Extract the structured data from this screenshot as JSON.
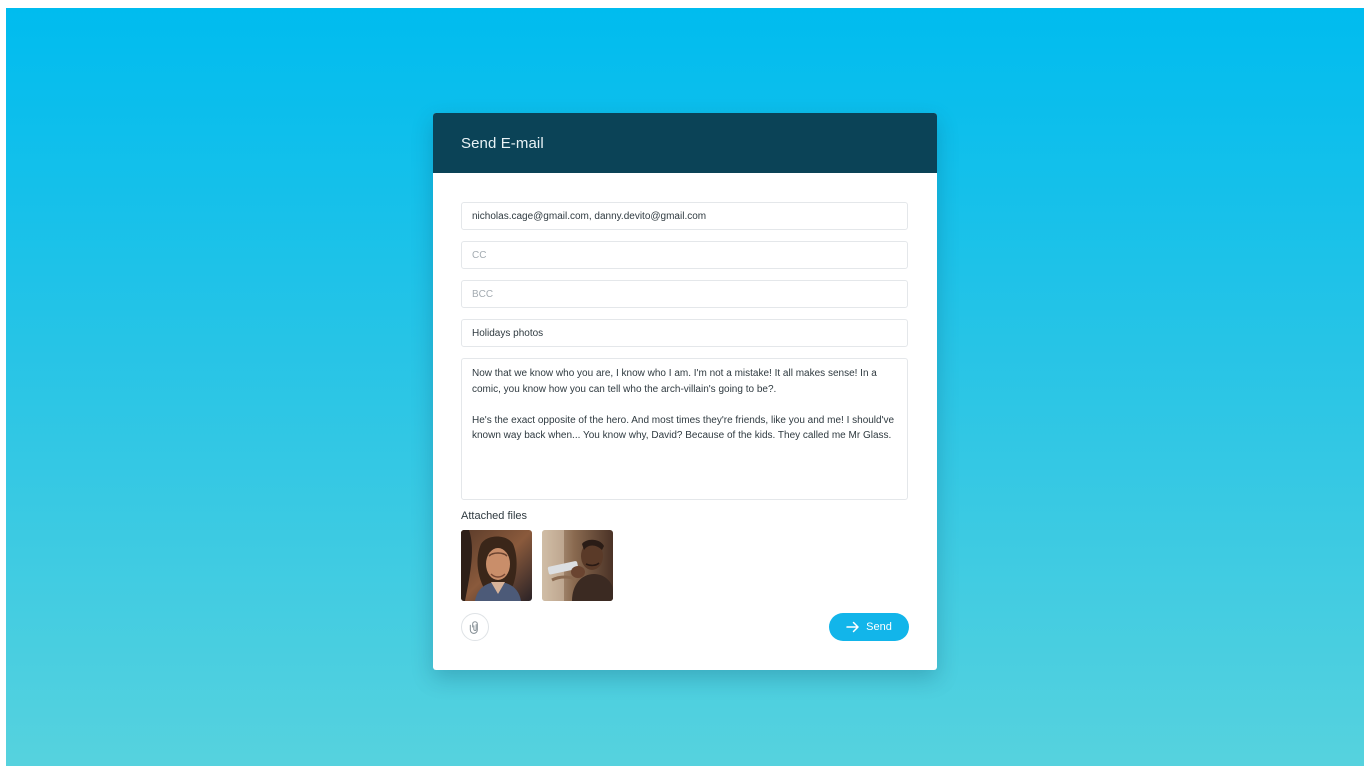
{
  "header": {
    "title": "Send E-mail"
  },
  "form": {
    "to_value": "nicholas.cage@gmail.com, danny.devito@gmail.com",
    "cc_placeholder": "CC",
    "bcc_placeholder": "BCC",
    "subject_value": "Holidays photos",
    "message_paragraphs": [
      "Now that we know who you are, I know who I am. I'm not a mistake! It all makes sense! In a comic, you know how you can tell who the arch-villain's going to be?.",
      "He's the exact opposite of the hero. And most times they're friends, like you and me! I should've known way back when... You know why, David? Because of the kids. They called me Mr Glass."
    ]
  },
  "attachments": {
    "label": "Attached files"
  },
  "footer": {
    "attach_icon": "paperclip-icon",
    "send_icon": "arrow-right-icon",
    "send_label": "Send"
  },
  "colors": {
    "header_bg": "#0b4357",
    "accent": "#12b5ea",
    "background_top": "#00bcef",
    "background_bottom": "#56d2de"
  }
}
